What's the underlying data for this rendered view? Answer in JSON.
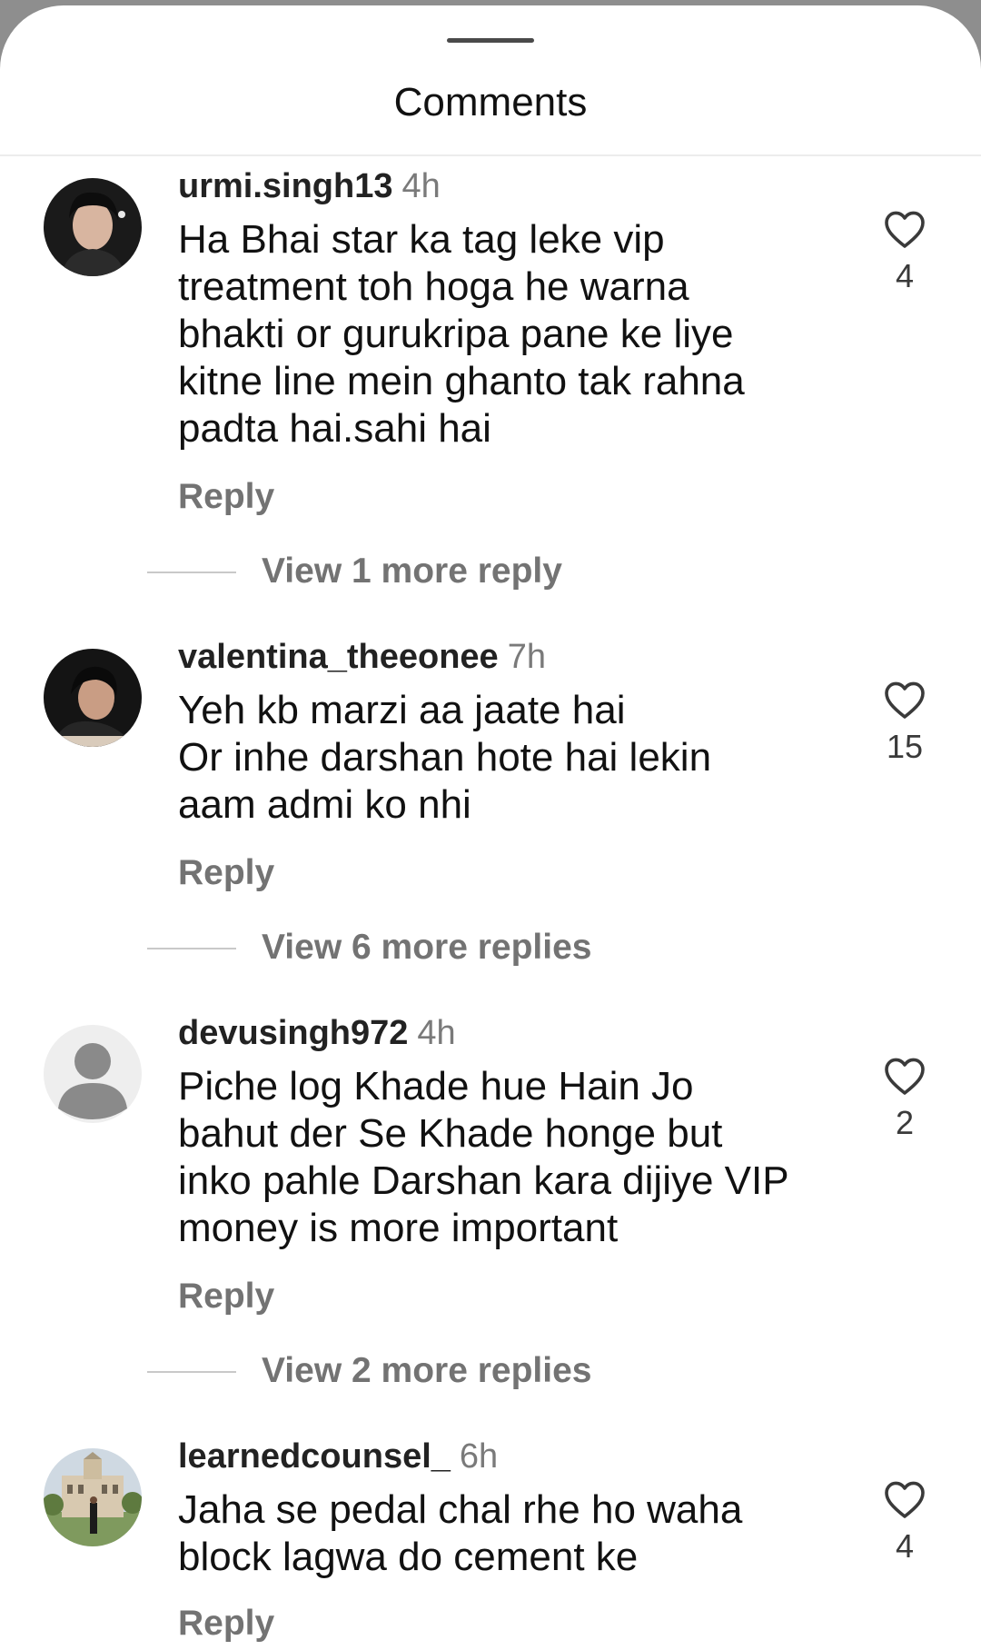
{
  "header": {
    "title": "Comments"
  },
  "comments": [
    {
      "username": "urmi.singh13",
      "time": "4h",
      "text": "Ha Bhai star ka tag leke vip\ntreatment toh hoga he warna\nbhakti or gurukripa pane ke liye\nkitne line mein ghanto tak rahna\npadta hai.sahi hai",
      "likes": "4",
      "reply_label": "Reply",
      "view_replies": "View 1 more reply",
      "avatar_icon": "profile-photo"
    },
    {
      "username": "valentina_theeonee",
      "time": "7h",
      "text": "Yeh kb marzi aa jaate hai\nOr inhe darshan hote hai lekin\naam admi ko nhi",
      "likes": "15",
      "reply_label": "Reply",
      "view_replies": "View 6 more replies",
      "avatar_icon": "profile-photo"
    },
    {
      "username": "devusingh972",
      "time": "4h",
      "text": "Piche log Khade hue Hain Jo\nbahut der Se Khade honge but\ninko pahle Darshan kara dijiye VIP\nmoney is more important",
      "likes": "2",
      "reply_label": "Reply",
      "view_replies": "View 2 more replies",
      "avatar_icon": "default-user-icon"
    },
    {
      "username": "learnedcounsel_",
      "time": "6h",
      "text": "Jaha se pedal chal rhe ho waha\nblock lagwa do cement ke",
      "likes": "4",
      "reply_label": "Reply",
      "avatar_icon": "profile-photo"
    }
  ],
  "icons": {
    "like": "heart-outline-icon"
  },
  "colors": {
    "username": "#222222",
    "secondary_text": "#737373",
    "body_text": "#111111",
    "backdrop": "#8e8e8e"
  }
}
